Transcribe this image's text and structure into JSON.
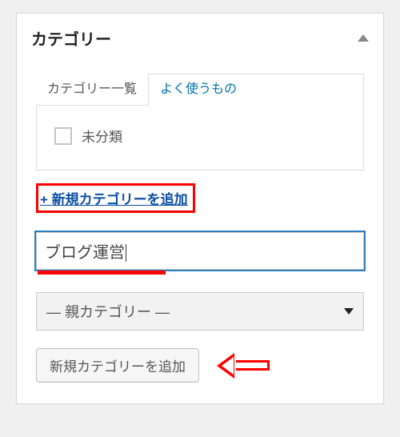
{
  "metabox": {
    "title": "カテゴリー"
  },
  "tabs": {
    "all": "カテゴリー一覧",
    "popular": "よく使うもの"
  },
  "categories": {
    "items": [
      {
        "label": "未分類",
        "checked": false
      }
    ]
  },
  "add_new": {
    "toggle_prefix": "+ ",
    "toggle_label": "新規カテゴリーを追加"
  },
  "new_category": {
    "value": "ブログ運営"
  },
  "parent_select": {
    "placeholder": "— 親カテゴリー —"
  },
  "submit": {
    "label": "新規カテゴリーを追加"
  },
  "annotation_colors": {
    "highlight": "#ff0000"
  }
}
